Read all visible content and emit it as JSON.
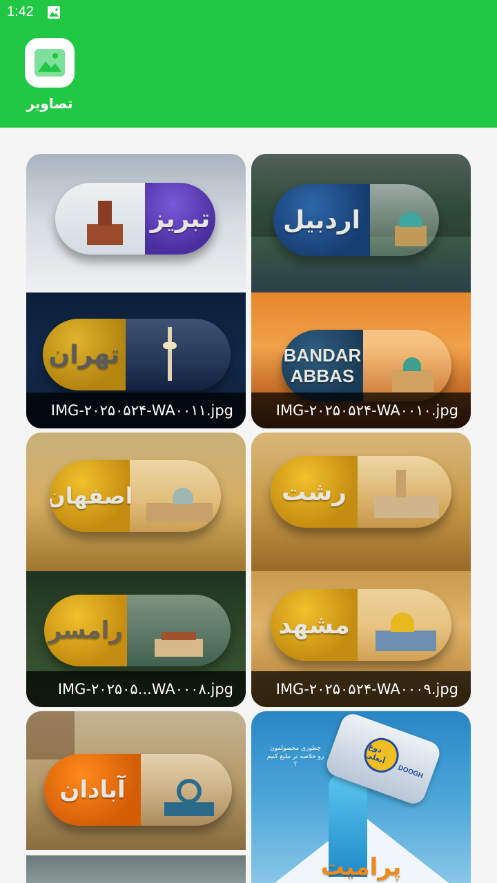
{
  "status_bar": {
    "time": "1:42"
  },
  "app": {
    "title": "تصاویر"
  },
  "images": [
    {
      "caption": "IMG-۲۰۲۵۰۵۲۴-WA۰۰۱۰.jpg",
      "top_label": "اردبیل",
      "bottom_label_1": "BANDAR",
      "bottom_label_2": "ABBAS"
    },
    {
      "caption": "IMG-۲۰۲۵۰۵۲۴-WA۰۰۱۱.jpg",
      "top_label": "تبریز",
      "bottom_label": "تهران"
    },
    {
      "caption": "IMG-۲۰۲۵۰۵۲۴-WA۰۰۰۹.jpg",
      "top_label": "رشت",
      "bottom_label": "مشهد"
    },
    {
      "caption": "IMG-۲۰۲۵۰۵...WA۰۰۰۸.jpg",
      "top_label": "اصفهان",
      "bottom_label": "رامسر"
    },
    {
      "top_label": "آبادان"
    },
    {
      "ad_text": "چطوری محصولمون رو خلاصه تر تبلیغ کنیم ؟",
      "brand": "دوغ آبعلی",
      "brand_en": "DOOGH",
      "title": "پرامیت"
    }
  ],
  "colors": {
    "primary": "#20c844",
    "background": "#f5f5f5"
  }
}
